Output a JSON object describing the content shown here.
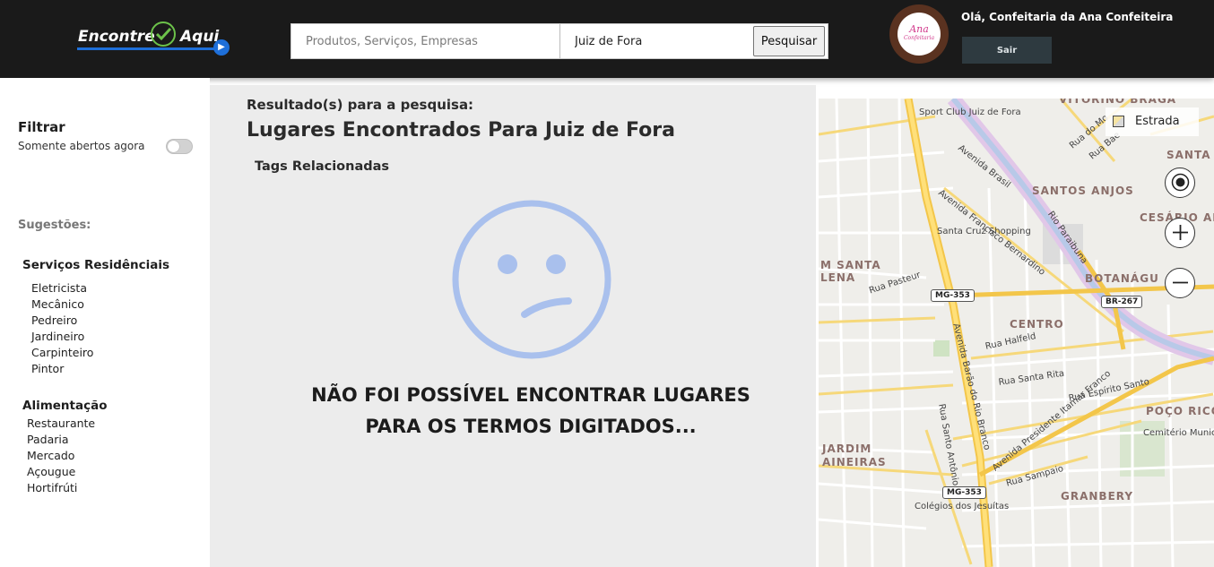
{
  "header": {
    "logo": {
      "part1": "Encontre",
      "part2": "Aqui"
    },
    "search_placeholder": "Produtos, Serviços, Empresas",
    "city_value": "Juiz de Fora",
    "search_button": "Pesquisar",
    "avatar": {
      "name": "Ana",
      "sub": "Confeitaria"
    },
    "greeting": "Olá, Confeitaria da Ana Confeiteira",
    "logout_button": "Sair"
  },
  "sidebar": {
    "filter_title": "Filtrar",
    "open_now_label": "Somente abertos agora",
    "open_now_enabled": false,
    "suggestions_title": "Sugestões:",
    "categories": [
      {
        "title": "Serviços Residênciais",
        "items": [
          "Eletricista",
          "Mecânico",
          "Pedreiro",
          "Jardineiro",
          "Carpinteiro",
          "Pintor"
        ]
      },
      {
        "title": "Alimentação",
        "items": [
          "Restaurante",
          "Padaria",
          "Mercado",
          "Açougue",
          "Hortifrúti"
        ]
      }
    ]
  },
  "results": {
    "label": "Resultado(s) para a pesquisa:",
    "title": "Lugares Encontrados Para Juiz de Fora",
    "tags_title": "Tags Relacionadas",
    "empty_line1": "NÃO FOI POSSÍVEL ENCONTRAR LUGARES",
    "empty_line2": "PARA OS TERMOS DIGITADOS..."
  },
  "map": {
    "style_button": "Estrada",
    "districts": [
      "SANTOS ANJOS",
      "SANTA C",
      "CESÁRIO ALVI",
      "BOTANÁGU",
      "CENTRO",
      "POÇO RICO",
      "GRANBERY",
      "JARDIM",
      "AINEIRAS",
      "M SANTA",
      "LENA",
      "VITORINO BRAGA"
    ],
    "places": [
      "Sport Club Juiz de Fora",
      "Santa Cruz Shopping",
      "Cemitério Municipal Nossa Senhora Aparecida",
      "Colégios dos Jesuítas"
    ],
    "streets": [
      "Avenida Brasil",
      "Avenida Francisco Bernardino",
      "Rio Paraibuna",
      "Rua Pasteur",
      "Avenida Barão do Rio Branco",
      "Rua Halfeld",
      "Rua Santa Rita",
      "Avenida Presidente Itamar Franco",
      "Rua Espírito Santo",
      "Rua Santo Antônio",
      "Rua Sampaio",
      "Rua do Mo",
      "Rua Bae"
    ],
    "road_badges": [
      "MG-353",
      "BR-267",
      "MG-353"
    ],
    "controls": {
      "locate": "locate-icon",
      "zoom_in": "plus-icon",
      "zoom_out": "minus-icon"
    }
  }
}
